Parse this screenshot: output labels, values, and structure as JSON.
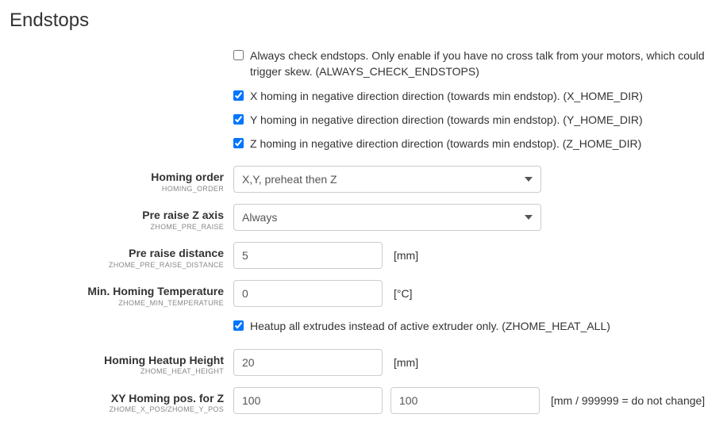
{
  "title": "Endstops",
  "checkboxes": {
    "always_check": {
      "label": "Always check endstops. Only enable if you have no cross talk from your motors, which could trigger skew. (ALWAYS_CHECK_ENDSTOPS)",
      "checked": false
    },
    "x_home_dir": {
      "label": "X homing in negative direction direction (towards min endstop). (X_HOME_DIR)",
      "checked": true
    },
    "y_home_dir": {
      "label": "Y homing in negative direction direction (towards min endstop). (Y_HOME_DIR)",
      "checked": true
    },
    "z_home_dir": {
      "label": "Z homing in negative direction direction (towards min endstop). (Z_HOME_DIR)",
      "checked": true
    },
    "heat_all": {
      "label": "Heatup all extrudes instead of active extruder only. (ZHOME_HEAT_ALL)",
      "checked": true
    }
  },
  "fields": {
    "homing_order": {
      "label": "Homing order",
      "sub": "HOMING_ORDER",
      "value": "X,Y, preheat then Z"
    },
    "pre_raise": {
      "label": "Pre raise Z axis",
      "sub": "ZHOME_PRE_RAISE",
      "value": "Always"
    },
    "pre_raise_distance": {
      "label": "Pre raise distance",
      "sub": "ZHOME_PRE_RAISE_DISTANCE",
      "value": "5",
      "unit": "[mm]"
    },
    "min_homing_temp": {
      "label": "Min. Homing Temperature",
      "sub": "ZHOME_MIN_TEMPERATURE",
      "value": "0",
      "unit": "[°C]"
    },
    "heatup_height": {
      "label": "Homing Heatup Height",
      "sub": "ZHOME_HEAT_HEIGHT",
      "value": "20",
      "unit": "[mm]"
    },
    "xy_pos_z": {
      "label": "XY Homing pos. for Z",
      "sub": "ZHOME_X_POS/ZHOME_Y_POS",
      "x": "100",
      "y": "100",
      "unit": "[mm / 999999 = do not change]"
    }
  }
}
